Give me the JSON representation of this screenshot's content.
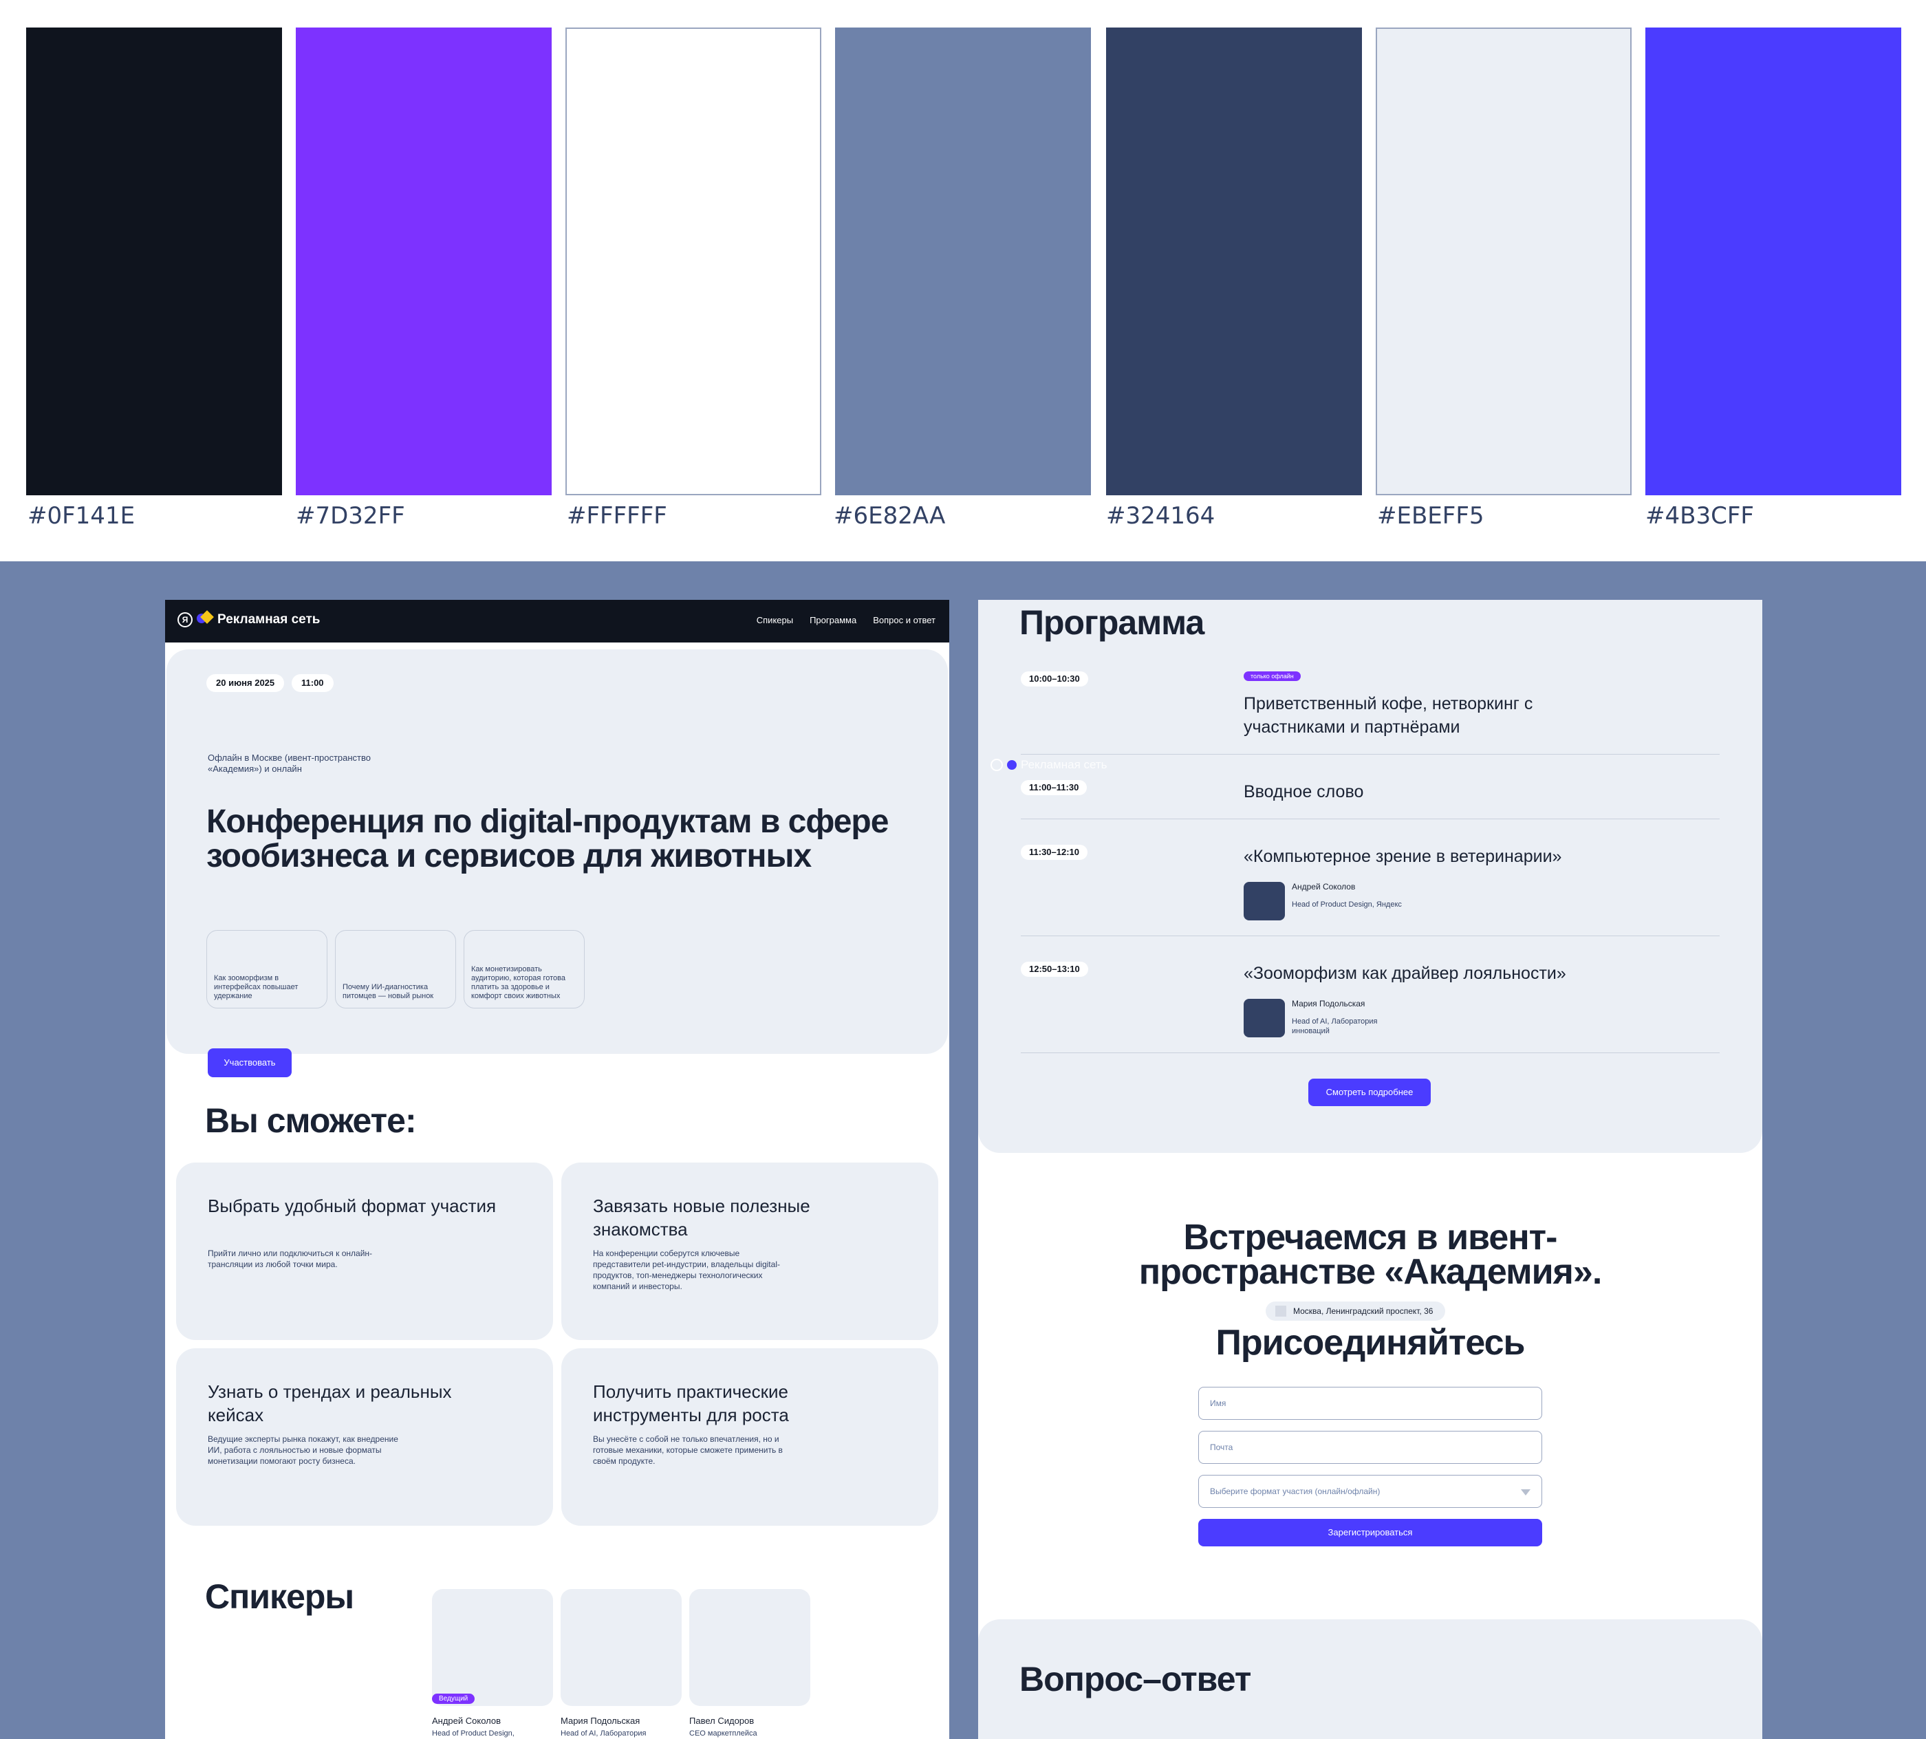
{
  "palette": [
    {
      "hex": "#0F141E",
      "label": "#0F141E"
    },
    {
      "hex": "#7D32FF",
      "label": "#7D32FF"
    },
    {
      "hex": "#FFFFFF",
      "label": "#FFFFFF"
    },
    {
      "hex": "#6E82AA",
      "label": "#6E82AA"
    },
    {
      "hex": "#324164",
      "label": "#324164"
    },
    {
      "hex": "#EBEFF5",
      "label": "#EBEFF5"
    },
    {
      "hex": "#4B3CFF",
      "label": "#4B3CFF"
    }
  ],
  "brand": {
    "logo_letter": "Я",
    "name": "Рекламная сеть"
  },
  "nav": {
    "speakers": "Спикеры",
    "program": "Программа",
    "faq": "Вопрос и ответ"
  },
  "hero": {
    "date": "20 июня 2025",
    "time": "11:00",
    "location": "Офлайн в Москве (ивент-пространство «Академия») и онлайн",
    "title": "Конференция по digital-продуктам в сфере зообизнеса и сервисов для животных",
    "topics": [
      "Как зооморфизм в интерфейсах повышает удержание",
      "Почему ИИ-диагностика питомцев — новый рынок",
      "Как монетизировать аудиторию, которая готова платить за здоровье и комфорт своих животных"
    ],
    "cta": "Участвовать"
  },
  "benefits": {
    "heading": "Вы сможете:",
    "items": [
      {
        "title": "Выбрать удобный формат участия",
        "desc": "Прийти лично или подключиться к онлайн-трансляции из любой точки мира."
      },
      {
        "title": "Завязать новые полезные знакомства",
        "desc": "На конференции соберутся ключевые представители pet-индустрии, владельцы digital-продуктов, топ-менеджеры технологических компаний и инвесторы."
      },
      {
        "title": "Узнать о трендах и реальных кейсах",
        "desc": "Ведущие эксперты рынка покажут, как внедрение ИИ, работа с лояльностью и новые форматы монетизации помогают росту бизнеса."
      },
      {
        "title": "Получить практические инструменты для роста",
        "desc": "Вы унесёте с собой не только впечатления, но и готовые механики, которые сможете применить в своём продукте."
      }
    ]
  },
  "speakers": {
    "heading": "Спикеры",
    "host_badge": "Ведущий",
    "items": [
      {
        "name": "Андрей Соколов",
        "role": "Head of Product Design,"
      },
      {
        "name": "Мария Подольская",
        "role": "Head of AI, Лаборатория"
      },
      {
        "name": "Павел Сидоров",
        "role": "CEO маркетплейса"
      }
    ]
  },
  "program": {
    "heading": "Программа",
    "offline_badge": "только офлайн",
    "watermark": "Рекламная сеть",
    "items": [
      {
        "time": "10:00–10:30",
        "title": "Приветственный кофе, нетворкинг с участниками и партнёрами"
      },
      {
        "time": "11:00–11:30",
        "title": "Вводное слово"
      },
      {
        "time": "11:30–12:10",
        "title": "«Компьютерное зрение в ветеринарии»",
        "speaker": "Андрей Соколов",
        "role": "Head of Product Design, Яндекс"
      },
      {
        "time": "12:50–13:10",
        "title": "«Зооморфизм как драйвер лояльности»",
        "speaker": "Мария Подольская",
        "role": "Head of AI, Лаборатория инноваций"
      }
    ],
    "more": "Смотреть подробнее"
  },
  "venue": {
    "title": "Встречаемся в ивент-пространстве «Академия».",
    "address": "Москва, Ленинградский проспект, 36"
  },
  "join": {
    "heading": "Присоединяйтесь",
    "name_placeholder": "Имя",
    "email_placeholder": "Почта",
    "format_placeholder": "Выберите формат участия (онлайн/офлайн)",
    "submit": "Зарегистрироваться"
  },
  "faq": {
    "heading": "Вопрос–ответ"
  }
}
